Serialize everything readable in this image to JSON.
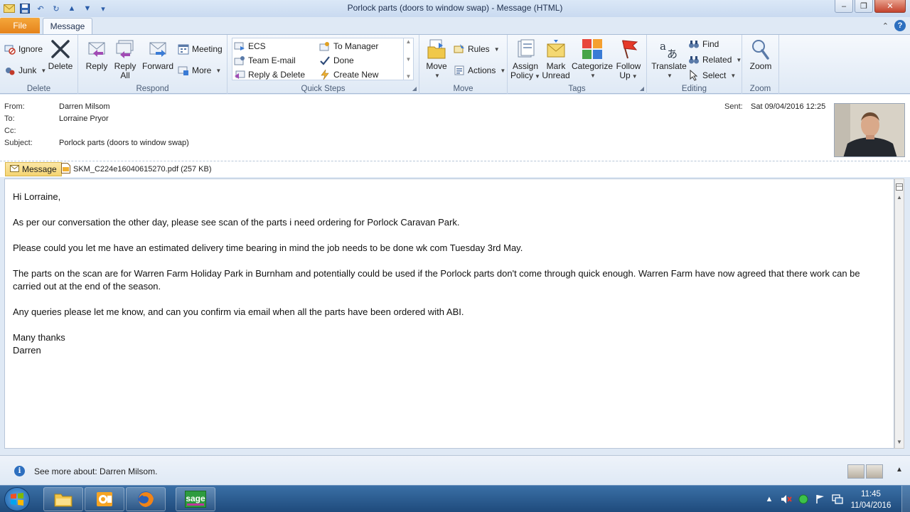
{
  "window": {
    "title": "Porlock parts (doors to window swap)  -  Message (HTML)",
    "minimize": "–",
    "maximize": "❐",
    "close": "✕"
  },
  "tabs": {
    "file": "File",
    "message": "Message"
  },
  "ribbon": {
    "delete_group": {
      "label": "Delete",
      "ignore": "Ignore",
      "junk": "Junk",
      "delete": "Delete"
    },
    "respond_group": {
      "label": "Respond",
      "reply": "Reply",
      "reply_all_1": "Reply",
      "reply_all_2": "All",
      "forward": "Forward",
      "meeting": "Meeting",
      "more": "More"
    },
    "quick_steps_group": {
      "label": "Quick Steps",
      "items": [
        "ECS",
        "Team E-mail",
        "Reply & Delete",
        "To Manager",
        "Done",
        "Create New"
      ]
    },
    "move_group": {
      "label": "Move",
      "move": "Move",
      "rules": "Rules",
      "actions": "Actions"
    },
    "tags_group": {
      "label": "Tags",
      "assign_1": "Assign",
      "assign_2": "Policy",
      "mark_1": "Mark",
      "mark_2": "Unread",
      "categorize": "Categorize",
      "follow_1": "Follow",
      "follow_2": "Up"
    },
    "editing_group": {
      "label": "Editing",
      "translate": "Translate",
      "find": "Find",
      "related": "Related",
      "select": "Select"
    },
    "zoom_group": {
      "label": "Zoom",
      "zoom": "Zoom"
    }
  },
  "header": {
    "from_label": "From:",
    "from": "Darren Milsom",
    "to_label": "To:",
    "to": "Lorraine Pryor",
    "cc_label": "Cc:",
    "cc": "",
    "subject_label": "Subject:",
    "subject": "Porlock parts (doors to window swap)",
    "sent_label": "Sent:",
    "sent": "Sat 09/04/2016 12:25"
  },
  "attachments": {
    "message_tab": "Message",
    "file": "SKM_C224e16040615270.pdf (257 KB)"
  },
  "body": {
    "greeting": "Hi Lorraine,",
    "p1": "As per our conversation the other day, please see scan of the parts i need ordering for Porlock Caravan Park.",
    "p2": "Please could you let me have an estimated delivery time bearing in mind the job needs to be done wk com Tuesday 3rd May.",
    "p3": "The parts on the scan are for Warren Farm Holiday Park in Burnham and potentially could be used if the Porlock parts don't come through quick enough. Warren Farm have now agreed that there work can be carried out at the end of the season.",
    "p4": "Any queries please let me know, and can you confirm via email when all the parts have been ordered with ABI.",
    "closing": "Many thanks",
    "signature": "Darren"
  },
  "people_pane": {
    "text": "See more about: Darren Milsom."
  },
  "taskbar": {
    "apps": [
      "file-explorer",
      "outlook",
      "firefox",
      "sage"
    ],
    "sage_label": "sage",
    "time": "11:45",
    "date": "11/04/2016"
  },
  "colors": {
    "file_tab": "#e5831b",
    "ribbon_bg": "#dfe9f5",
    "taskbar": "#1f4b7c"
  }
}
